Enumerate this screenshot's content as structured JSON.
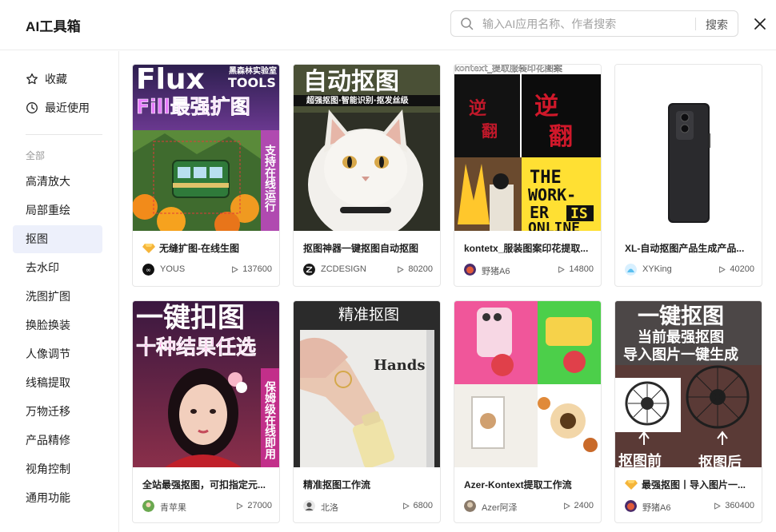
{
  "app": {
    "title": "AI工具箱"
  },
  "search": {
    "placeholder": "输入AI应用名称、作者搜索",
    "button": "搜索"
  },
  "sidebar": {
    "favorites": "收藏",
    "recent": "最近使用",
    "group_label": "全部",
    "categories": [
      "高清放大",
      "局部重绘",
      "抠图",
      "去水印",
      "洗图扩图",
      "换脸换装",
      "人像调节",
      "线稿提取",
      "万物迁移",
      "产品精修",
      "视角控制",
      "通用功能"
    ],
    "active_index": 2
  },
  "cards": [
    {
      "title": "无缝扩图-在线生图",
      "author": "YOUS",
      "runs": "137600",
      "badge": true,
      "thumb": {
        "top": "Flux",
        "brand": "黑森林实验室",
        "tools": "TOOLS",
        "sub": "Fill最强扩图",
        "side": "支持在线运行"
      }
    },
    {
      "title": "抠图神器一键抠图自动抠图",
      "author": "ZCDESIGN",
      "runs": "80200",
      "badge": false,
      "thumb": {
        "top": "自动抠图",
        "sub": "超强抠图·智能识别·抠发丝级"
      }
    },
    {
      "title": "kontetx_服装图案印花提取...",
      "author": "野猪A6",
      "runs": "14800",
      "badge": false,
      "thumb": {
        "top": "kontext_提取服装印花图案",
        "word1": "THE",
        "word2": "WORK-",
        "word3": "ER",
        "word4": "IS",
        "word5": "ONLINE"
      }
    },
    {
      "title": "XL-自动抠图产品生成产品...",
      "author": "XYKing",
      "runs": "40200",
      "badge": false,
      "thumb": {}
    },
    {
      "title": "全站最强抠图，可扣指定元...",
      "author": "青苹果",
      "runs": "27000",
      "badge": false,
      "thumb": {
        "top": "一键扣图",
        "sub": "十种结果任选",
        "side": "保姆级在线即用"
      }
    },
    {
      "title": "精准抠图工作流",
      "author": "北洛",
      "runs": "6800",
      "badge": false,
      "thumb": {
        "top": "精准抠图",
        "label": "Hands"
      }
    },
    {
      "title": "Azer-Kontext提取工作流",
      "author": "Azer阿泽",
      "runs": "2400",
      "badge": false,
      "thumb": {}
    },
    {
      "title": "最强抠图丨导入图片一...",
      "author": "野猪A6",
      "runs": "360400",
      "badge": true,
      "thumb": {
        "top": "一键抠图",
        "l2": "当前最强抠图",
        "l3": "导入图片一键生成",
        "before": "抠图前",
        "after": "抠图后"
      }
    }
  ],
  "colors": {
    "accent_active_bg": "#edf0fb",
    "border": "#e6e6e6",
    "text": "#1f1f1f",
    "muted": "#9a9a9a"
  },
  "icons": {
    "search": "search-icon",
    "close": "close-icon",
    "favorites": "star-icon",
    "recent": "clock-icon",
    "runs": "play-icon",
    "badge": "diamond-icon"
  }
}
